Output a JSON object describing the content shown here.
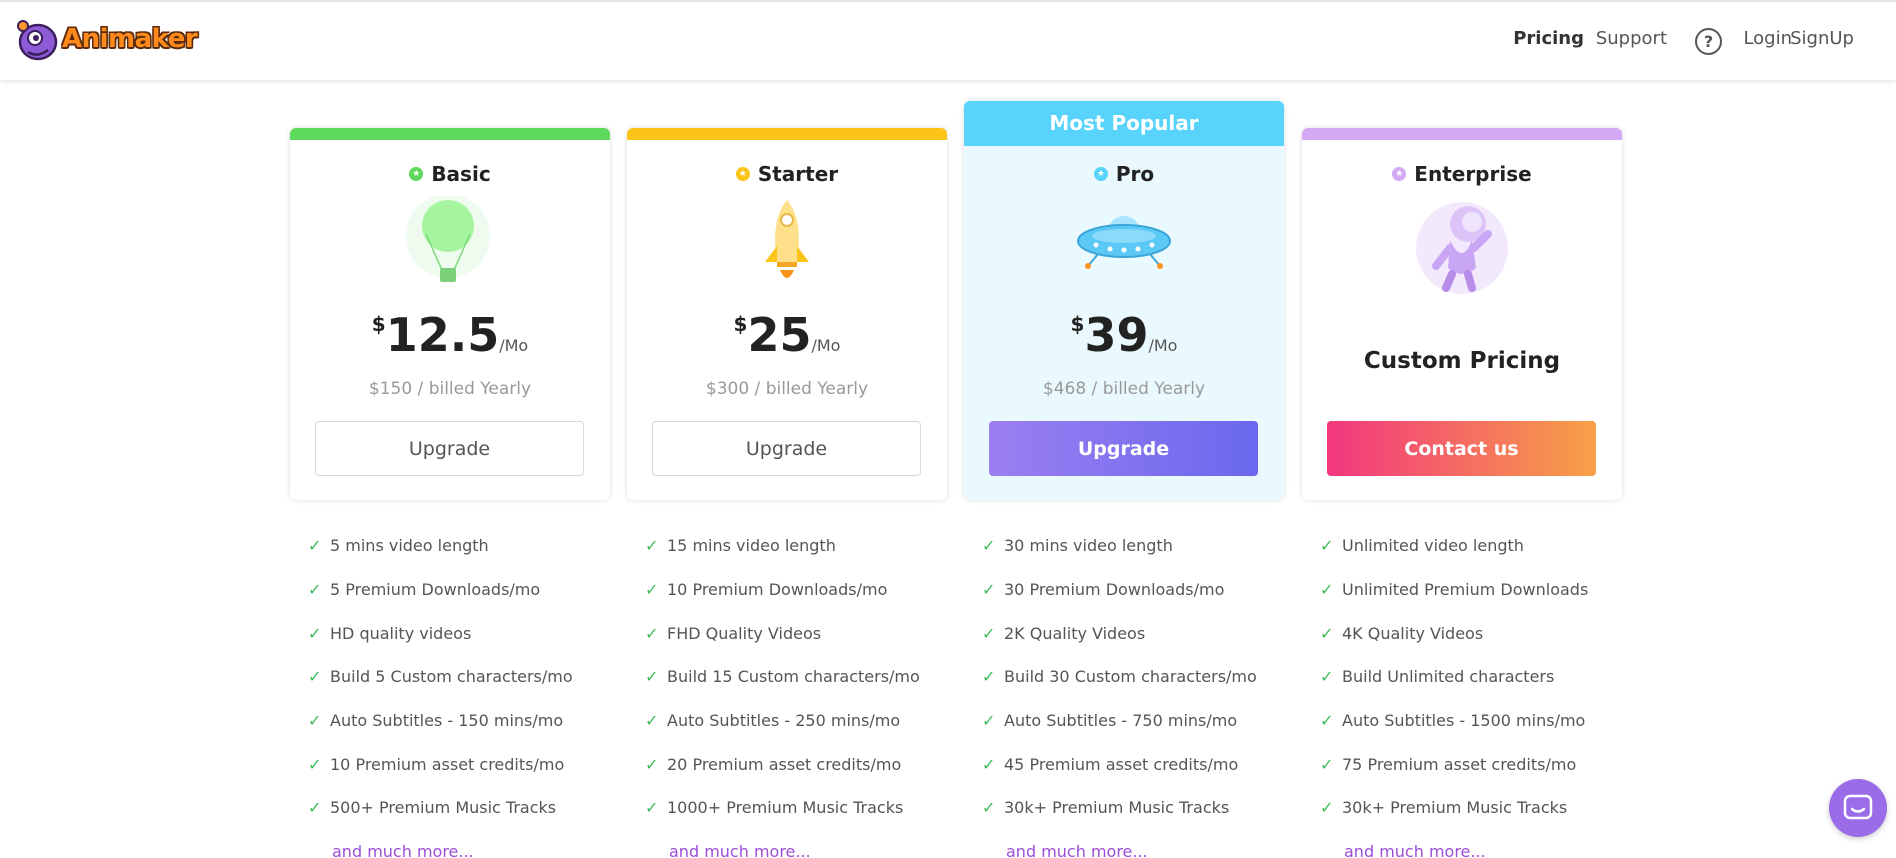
{
  "header": {
    "logo_text": "Animaker",
    "nav": {
      "pricing": "Pricing",
      "support": "Support",
      "help": "?",
      "login": "Login",
      "signup": "SignUp"
    }
  },
  "plans": [
    {
      "name": "Basic",
      "accent": "#5dd95b",
      "currency": "$",
      "price": "12.5",
      "per": "/Mo",
      "billed": "$150 / billed Yearly",
      "button": "Upgrade",
      "features": [
        "5 mins video length",
        "5 Premium Downloads/mo",
        "HD quality videos",
        "Build 5 Custom characters/mo",
        "Auto Subtitles - 150 mins/mo",
        "10 Premium asset credits/mo",
        "500+ Premium Music Tracks"
      ],
      "more": "and much more..."
    },
    {
      "name": "Starter",
      "accent": "#fcc419",
      "currency": "$",
      "price": "25",
      "per": "/Mo",
      "billed": "$300 / billed Yearly",
      "button": "Upgrade",
      "features": [
        "15 mins video length",
        "10 Premium Downloads/mo",
        "FHD Quality Videos",
        "Build 15 Custom characters/mo",
        "Auto Subtitles - 250 mins/mo",
        "20 Premium asset credits/mo",
        "1000+ Premium Music Tracks"
      ],
      "more": "and much more..."
    },
    {
      "name": "Pro",
      "badge": "Most Popular",
      "accent": "#58d3fb",
      "currency": "$",
      "price": "39",
      "per": "/Mo",
      "billed": "$468 / billed Yearly",
      "button": "Upgrade",
      "features": [
        "30 mins video length",
        "30 Premium Downloads/mo",
        "2K Quality Videos",
        "Build 30 Custom characters/mo",
        "Auto Subtitles - 750 mins/mo",
        "45 Premium asset credits/mo",
        "30k+ Premium Music Tracks"
      ],
      "more": "and much more..."
    },
    {
      "name": "Enterprise",
      "accent": "#d3a9f5",
      "custom": "Custom Pricing",
      "button": "Contact us",
      "features": [
        "Unlimited video length",
        "Unlimited Premium Downloads",
        "4K Quality Videos",
        "Build Unlimited characters",
        "Auto Subtitles - 1500 mins/mo",
        "75 Premium asset credits/mo",
        "30k+ Premium Music Tracks"
      ],
      "more": "and much more..."
    }
  ]
}
